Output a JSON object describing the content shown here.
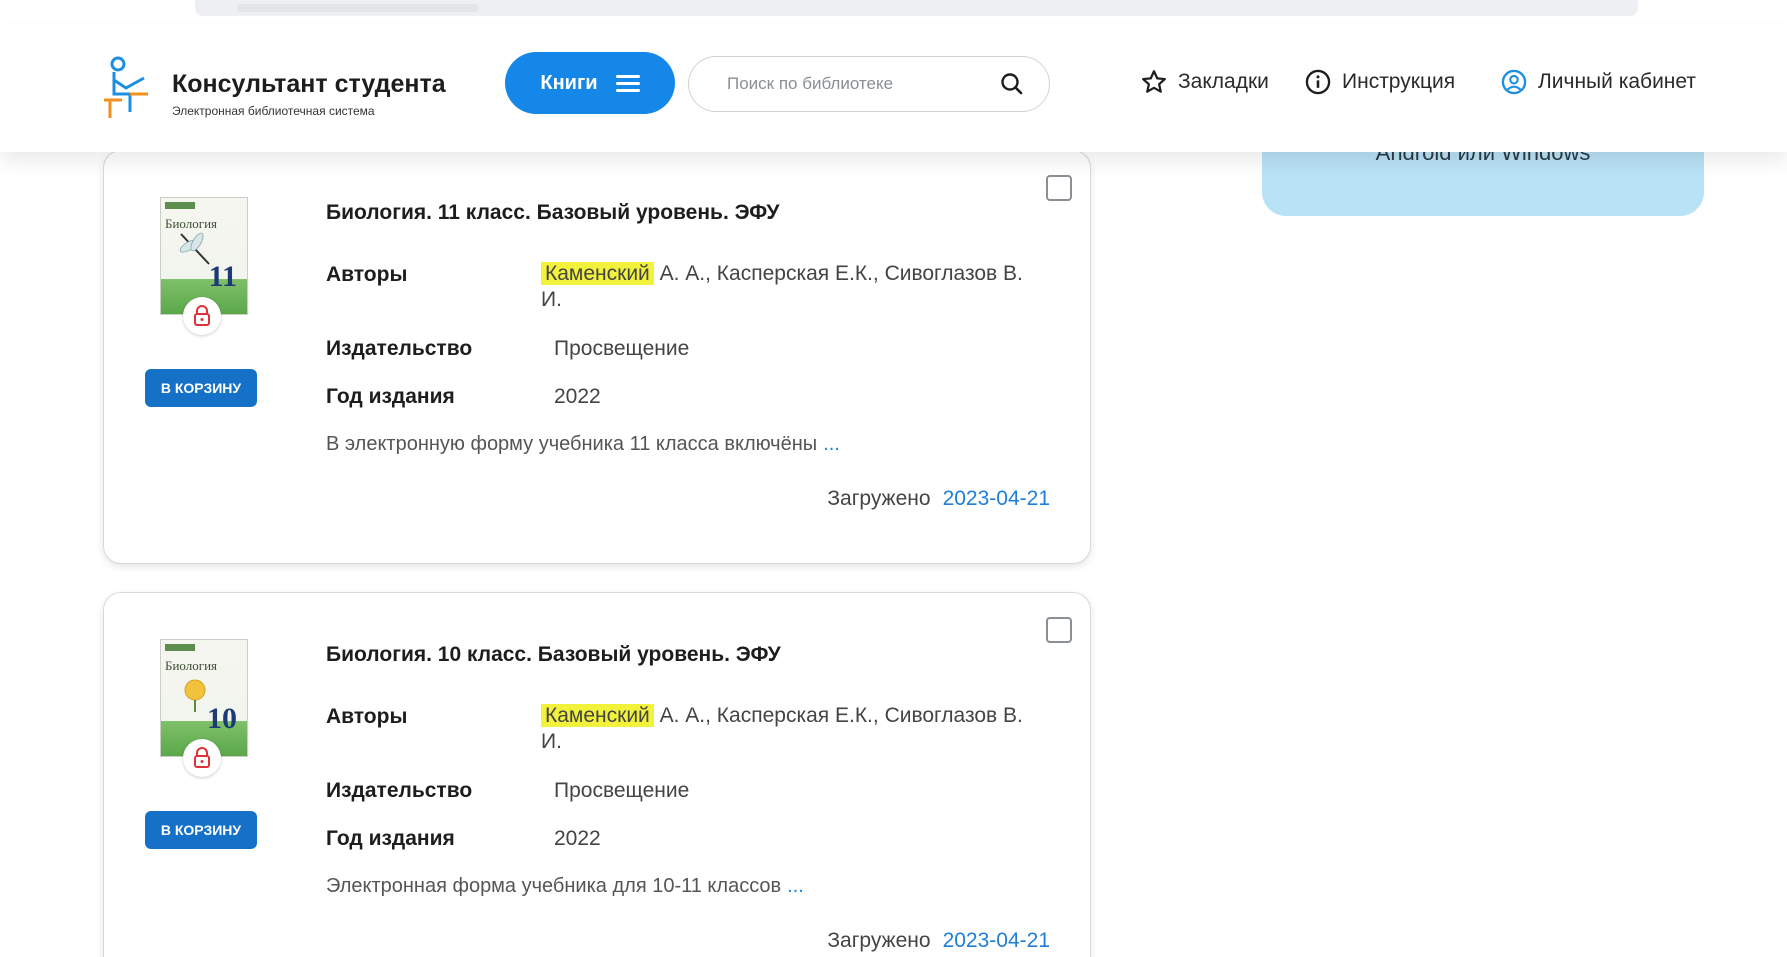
{
  "header": {
    "logo_title": "Консультант студента",
    "logo_subtitle": "Электронная библиотечная система",
    "books_label": "Книги",
    "search_placeholder": "Поиск по библиотеке",
    "nav": {
      "bookmarks": "Закладки",
      "instructions": "Инструкция",
      "account": "Личный кабинет"
    }
  },
  "side_panel": {
    "text": "Android или Windows"
  },
  "labels": {
    "authors": "Авторы",
    "publisher": "Издательство",
    "year": "Год издания",
    "uploaded": "Загружено",
    "cart": "В КОРЗИНУ",
    "more": "..."
  },
  "books": [
    {
      "title": "Биология. 11 класс. Базовый уровень. ЭФУ",
      "author_highlight": "Каменский",
      "authors_rest": "А. А., Касперская Е.К., Сивоглазов В. И.",
      "publisher": "Просвещение",
      "year": "2022",
      "description": "В электронную форму учебника 11 класса включёны",
      "uploaded_date": "2023-04-21",
      "cover_title": "Биология",
      "cover_number": "11"
    },
    {
      "title": "Биология. 10 класс. Базовый уровень. ЭФУ",
      "author_highlight": "Каменский",
      "authors_rest": "А. А., Касперская Е.К., Сивоглазов В. И.",
      "publisher": "Просвещение",
      "year": "2022",
      "description": "Электронная форма учебника для 10-11 классов",
      "uploaded_date": "2023-04-21",
      "cover_title": "Биология",
      "cover_number": "10"
    }
  ],
  "colors": {
    "accent": "#1587e8",
    "cart_button": "#1571c8",
    "highlight": "#f2f23c",
    "side_panel": "#b8e2f5"
  }
}
